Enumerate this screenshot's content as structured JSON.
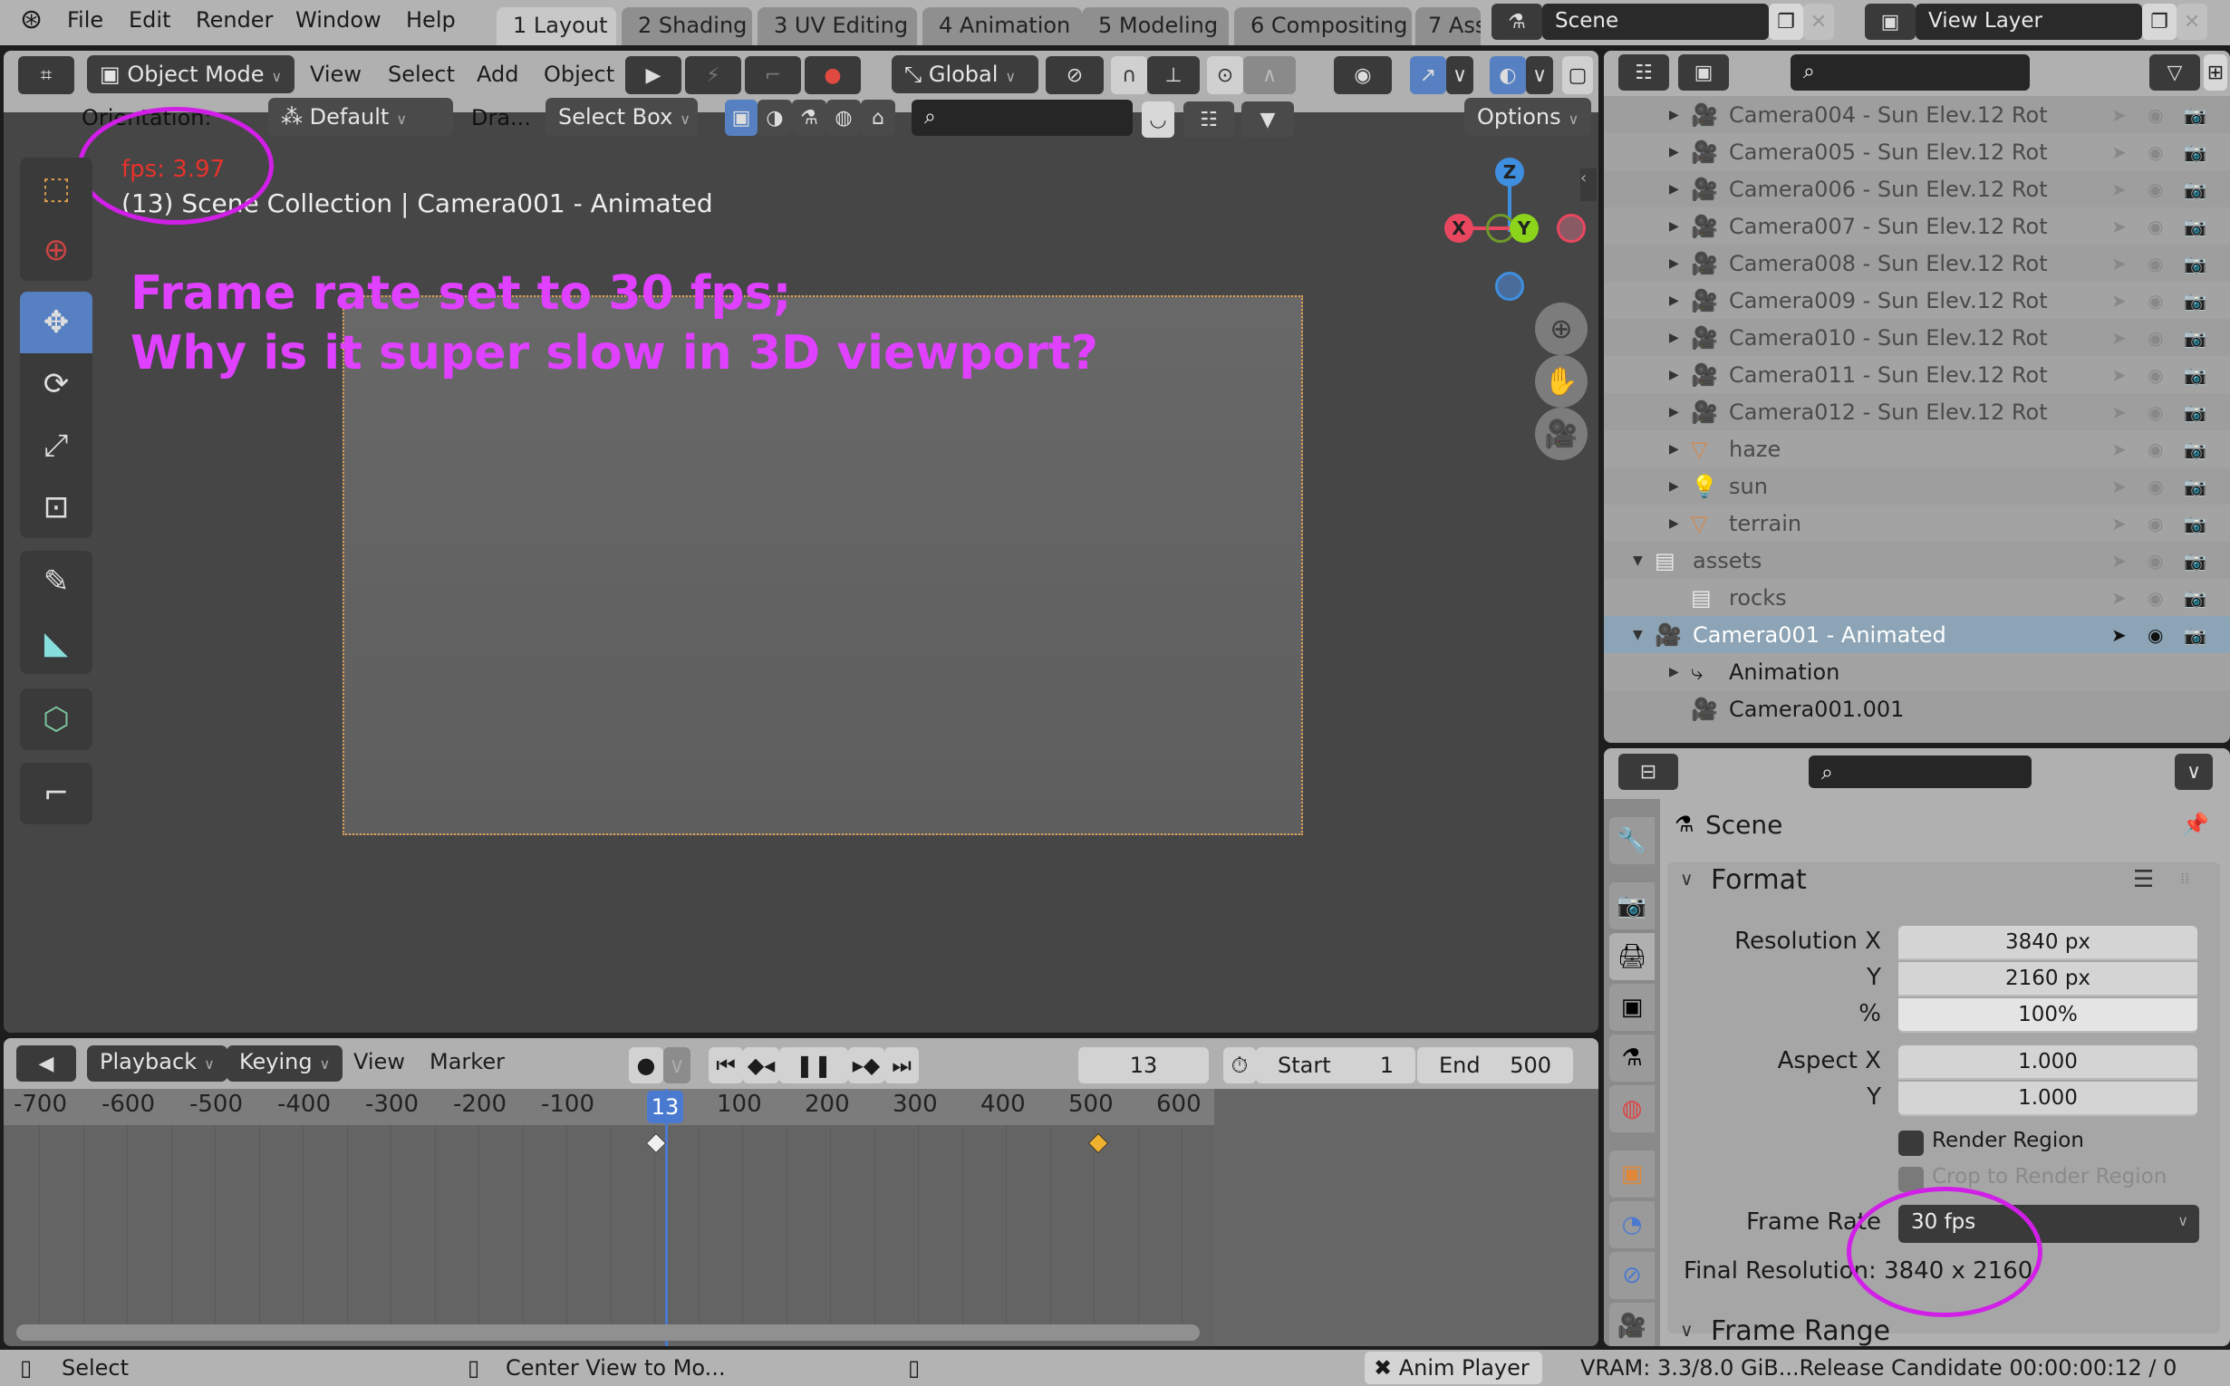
{
  "topbar": {
    "menu": [
      "File",
      "Edit",
      "Render",
      "Window",
      "Help"
    ],
    "workspace_tabs": [
      "1 Layout",
      "2 Shading",
      "3 UV Editing",
      "4 Animation",
      "5 Modeling",
      "6 Compositing",
      "7 Ass"
    ],
    "active_tab": "1 Layout",
    "scene_name": "Scene",
    "view_layer_name": "View Layer"
  },
  "viewport": {
    "mode": "Object Mode",
    "menus": [
      "View",
      "Select",
      "Add",
      "Object"
    ],
    "transform_orientation": "Global",
    "orientation_label": "Orientation:",
    "orientation_value": "Default",
    "drag_label": "Dra...",
    "drag_value": "Select Box",
    "options_label": "Options",
    "fps_readout": "fps: 3.97",
    "object_info": "(13) Scene Collection | Camera001 - Animated",
    "annotation_line1": "Frame rate set to 30 fps;",
    "annotation_line2": "Why is it super slow in 3D viewport?",
    "gizmo_axes": {
      "x": "X",
      "y": "Y",
      "z": "Z"
    },
    "colors": {
      "fps": "#e8322c",
      "annotation": "#e040ff",
      "active_tool": "#5680c2",
      "x_axis": "#e8475f",
      "y_axis": "#8cd41c",
      "z_axis": "#3f8fe0"
    }
  },
  "tools": [
    "select-box",
    "cursor",
    "move",
    "rotate",
    "scale",
    "transform",
    "annotate",
    "measure",
    "add-cube",
    "extrude"
  ],
  "timeline": {
    "menus": [
      "Playback",
      "Keying",
      "View",
      "Marker"
    ],
    "current_frame": "13",
    "start_label": "Start",
    "start_value": "1",
    "end_label": "End",
    "end_value": "500",
    "ticks": [
      "-700",
      "-600",
      "-500",
      "-400",
      "-300",
      "-200",
      "-100",
      "13",
      "100",
      "200",
      "300",
      "400",
      "500",
      "600"
    ],
    "keyframes": [
      13,
      500
    ]
  },
  "outliner": {
    "rows": [
      {
        "name": "Camera004 - Sun Elev.12  Rot",
        "type": "camera"
      },
      {
        "name": "Camera005 - Sun Elev.12  Rot",
        "type": "camera"
      },
      {
        "name": "Camera006 - Sun Elev.12  Rot",
        "type": "camera"
      },
      {
        "name": "Camera007 - Sun Elev.12  Rot",
        "type": "camera"
      },
      {
        "name": "Camera008 - Sun Elev.12  Rot",
        "type": "camera"
      },
      {
        "name": "Camera009 - Sun Elev.12  Rot",
        "type": "camera"
      },
      {
        "name": "Camera010 - Sun Elev.12  Rot",
        "type": "camera"
      },
      {
        "name": "Camera011 - Sun Elev.12  Rot",
        "type": "camera"
      },
      {
        "name": "Camera012 - Sun Elev.12  Rot",
        "type": "camera"
      },
      {
        "name": "haze",
        "type": "mesh"
      },
      {
        "name": "sun",
        "type": "light"
      },
      {
        "name": "terrain",
        "type": "mesh"
      },
      {
        "name": "assets",
        "type": "collection"
      },
      {
        "name": "rocks",
        "type": "collection"
      },
      {
        "name": "Camera001 - Animated",
        "type": "camera",
        "selected": true
      },
      {
        "name": "Animation",
        "type": "animation"
      },
      {
        "name": "Camera001.001",
        "type": "camera-data"
      }
    ]
  },
  "properties": {
    "context": "Scene",
    "format_panel": "Format",
    "resolution_x_label": "Resolution X",
    "resolution_x": "3840 px",
    "resolution_y_label": "Y",
    "resolution_y": "2160 px",
    "percent_label": "%",
    "percent": "100%",
    "aspect_x_label": "Aspect X",
    "aspect_x": "1.000",
    "aspect_y_label": "Y",
    "aspect_y": "1.000",
    "render_region": "Render Region",
    "crop_region": "Crop to Render Region",
    "frame_rate_label": "Frame Rate",
    "frame_rate": "30 fps",
    "final_resolution": "Final Resolution: 3840 x 2160",
    "frame_range_panel": "Frame Range"
  },
  "statusbar": {
    "select": "Select",
    "center_view": "Center View to Mo...",
    "anim_player": "Anim Player",
    "info": "VRAM: 3.3/8.0 GiB...Release Candidate  00:00:00:12 / 0"
  }
}
